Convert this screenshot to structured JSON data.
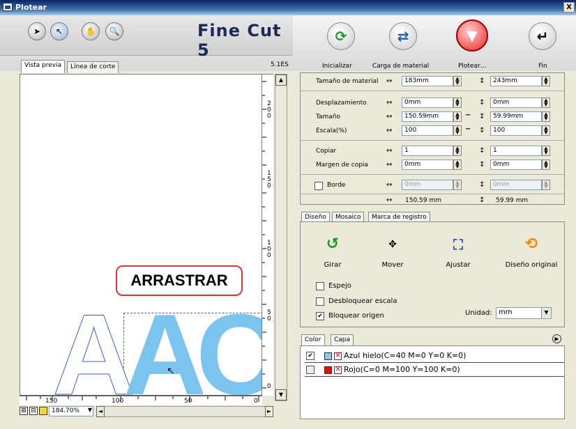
{
  "window": {
    "title": "Plotear",
    "close_label": "X"
  },
  "header": {
    "logo": "Fine Cut 5",
    "tools": [
      "select-arrow-icon",
      "pointer-icon",
      "hand-icon",
      "zoom-icon"
    ],
    "buttons": [
      {
        "label": "Inicializar",
        "icon": "refresh-icon"
      },
      {
        "label": "Carga de material",
        "icon": "swap-arrows-icon"
      },
      {
        "label": "Plotear…",
        "icon": "plotter-icon"
      },
      {
        "label": "Fin",
        "icon": "return-icon"
      }
    ]
  },
  "left": {
    "tabs": [
      "Vista previa",
      "Línea de corte"
    ],
    "version": "5.1ES",
    "drag_label": "ARRASTRAR",
    "letters": [
      "A",
      "A",
      "C"
    ],
    "vruler_labels": [
      "200",
      "150",
      "100",
      "50",
      "0"
    ],
    "hruler_labels": [
      "150",
      "100",
      "50",
      "0"
    ],
    "zoom": "184.70%"
  },
  "props": {
    "material_size": {
      "label": "Tamaño de material",
      "w": "183mm",
      "h": "243mm"
    },
    "offset": {
      "label": "Desplazamiento",
      "w": "0mm",
      "h": "0mm"
    },
    "size": {
      "label": "Tamaño",
      "w": "150.59mm",
      "h": "59.99mm"
    },
    "scale": {
      "label": "Escala(%)",
      "w": "100",
      "h": "100"
    },
    "copy": {
      "label": "Copiar",
      "w": "1",
      "h": "1"
    },
    "copy_margin": {
      "label": "Margen de copia",
      "w": "0mm",
      "h": "0mm"
    },
    "border": {
      "label": "Borde",
      "w": "0mm",
      "h": "0mm"
    },
    "totals": {
      "w": "150.59 mm",
      "h": "59.99 mm"
    }
  },
  "design": {
    "tabs": [
      "Diseño",
      "Mosaico",
      "Marca de registro"
    ],
    "actions": [
      "Girar",
      "Mover",
      "Ajustar",
      "Diseño original"
    ],
    "checks": [
      {
        "label": "Espejo",
        "checked": false
      },
      {
        "label": "Desbloquear escala",
        "checked": false
      },
      {
        "label": "Bloquear origen",
        "checked": true
      }
    ],
    "unit_label": "Unidad:",
    "unit_value": "mm"
  },
  "colors_panel": {
    "tabs": [
      "Color",
      "Capa"
    ],
    "rows": [
      {
        "checked": true,
        "swatch": "#8ec6f0",
        "label": "Azul hielo(C=40 M=0 Y=0 K=0)"
      },
      {
        "checked": false,
        "swatch": "#e01010",
        "label": "Rojo(C=0 M=100 Y=100 K=0)"
      }
    ]
  },
  "accent": {
    "letter_blue": "#7cc4f0",
    "outline_blue": "#3a5fd0",
    "drag_border": "#d33333"
  }
}
